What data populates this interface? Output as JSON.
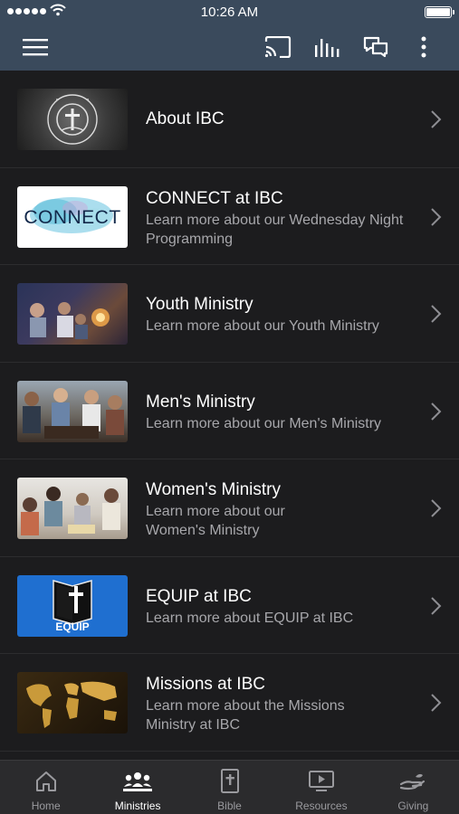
{
  "status_bar": {
    "time": "10:26 AM"
  },
  "list": [
    {
      "title": "About IBC",
      "subtitle": ""
    },
    {
      "title": "CONNECT at IBC",
      "subtitle": "Learn more about our Wednesday Night Programming"
    },
    {
      "title": "Youth Ministry",
      "subtitle": "Learn more about our Youth Ministry"
    },
    {
      "title": "Men's Ministry",
      "subtitle": "Learn more about our Men's Ministry"
    },
    {
      "title": "Women's Ministry",
      "subtitle": "Learn more about our Women's Ministry"
    },
    {
      "title": "EQUIP at IBC",
      "subtitle": "Learn more about EQUIP at IBC"
    },
    {
      "title": "Missions at IBC",
      "subtitle": "Learn more about the Missions Ministry at IBC"
    }
  ],
  "thumbs": {
    "about": "IMMANUEL BAPTIST CHURCH",
    "connect": "CONNECT",
    "equip": "EQUIP"
  },
  "tabs": [
    {
      "label": "Home",
      "icon": "home-icon"
    },
    {
      "label": "Ministries",
      "icon": "people-icon"
    },
    {
      "label": "Bible",
      "icon": "bible-icon"
    },
    {
      "label": "Resources",
      "icon": "video-icon"
    },
    {
      "label": "Giving",
      "icon": "giving-hand-icon"
    }
  ],
  "active_tab": "Ministries",
  "colors": {
    "header": "#3a4a5c",
    "background": "#1c1c1e",
    "tabbar": "#2b2b2d",
    "equip_blue": "#1f6fd0"
  }
}
